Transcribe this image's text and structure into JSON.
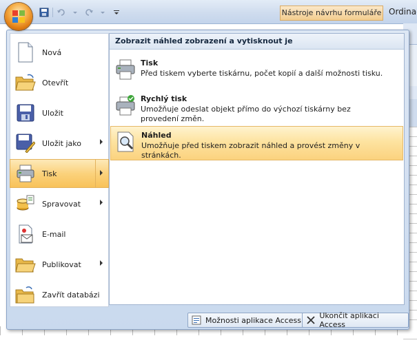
{
  "title_bar": {
    "contextual_tools_label": "Nástroje návrhu formuláře",
    "app_title": "Ordinac"
  },
  "menu": {
    "left_items": [
      {
        "label": "Nová",
        "icon": "new-document-icon",
        "has_submenu": false
      },
      {
        "label": "Otevřít",
        "icon": "open-folder-icon",
        "has_submenu": false
      },
      {
        "label": "Uložit",
        "icon": "save-disk-icon",
        "has_submenu": false
      },
      {
        "label": "Uložit jako",
        "icon": "save-as-icon",
        "has_submenu": true
      },
      {
        "label": "Tisk",
        "icon": "printer-icon",
        "has_submenu": true,
        "selected": true
      },
      {
        "label": "Spravovat",
        "icon": "manage-icon",
        "has_submenu": true
      },
      {
        "label": "E-mail",
        "icon": "email-icon",
        "has_submenu": false
      },
      {
        "label": "Publikovat",
        "icon": "publish-folder-icon",
        "has_submenu": true
      },
      {
        "label": "Zavřít databázi",
        "icon": "close-database-icon",
        "has_submenu": false
      }
    ],
    "submenu_title": "Zobrazit náhled zobrazení a vytisknout je",
    "submenu_items": [
      {
        "title": "Tisk",
        "description": "Před tiskem vyberte tiskárnu, počet kopií a další možnosti tisku.",
        "icon": "printer-icon"
      },
      {
        "title": "Rychlý tisk",
        "description": "Umožňuje odeslat objekt přímo do výchozí tiskárny bez provedení změn.",
        "icon": "quick-print-icon"
      },
      {
        "title": "Náhled",
        "description": "Umožňuje před tiskem zobrazit náhled a provést změny v stránkách.",
        "icon": "print-preview-icon",
        "highlighted": true
      }
    ],
    "bottom_buttons": {
      "options_label": "Možnosti aplikace Access",
      "exit_label": "Ukončit aplikaci Access"
    }
  },
  "colors": {
    "highlight": "#fbd27c",
    "menu_bg": "#dde7f4",
    "border": "#8aa3c7"
  }
}
